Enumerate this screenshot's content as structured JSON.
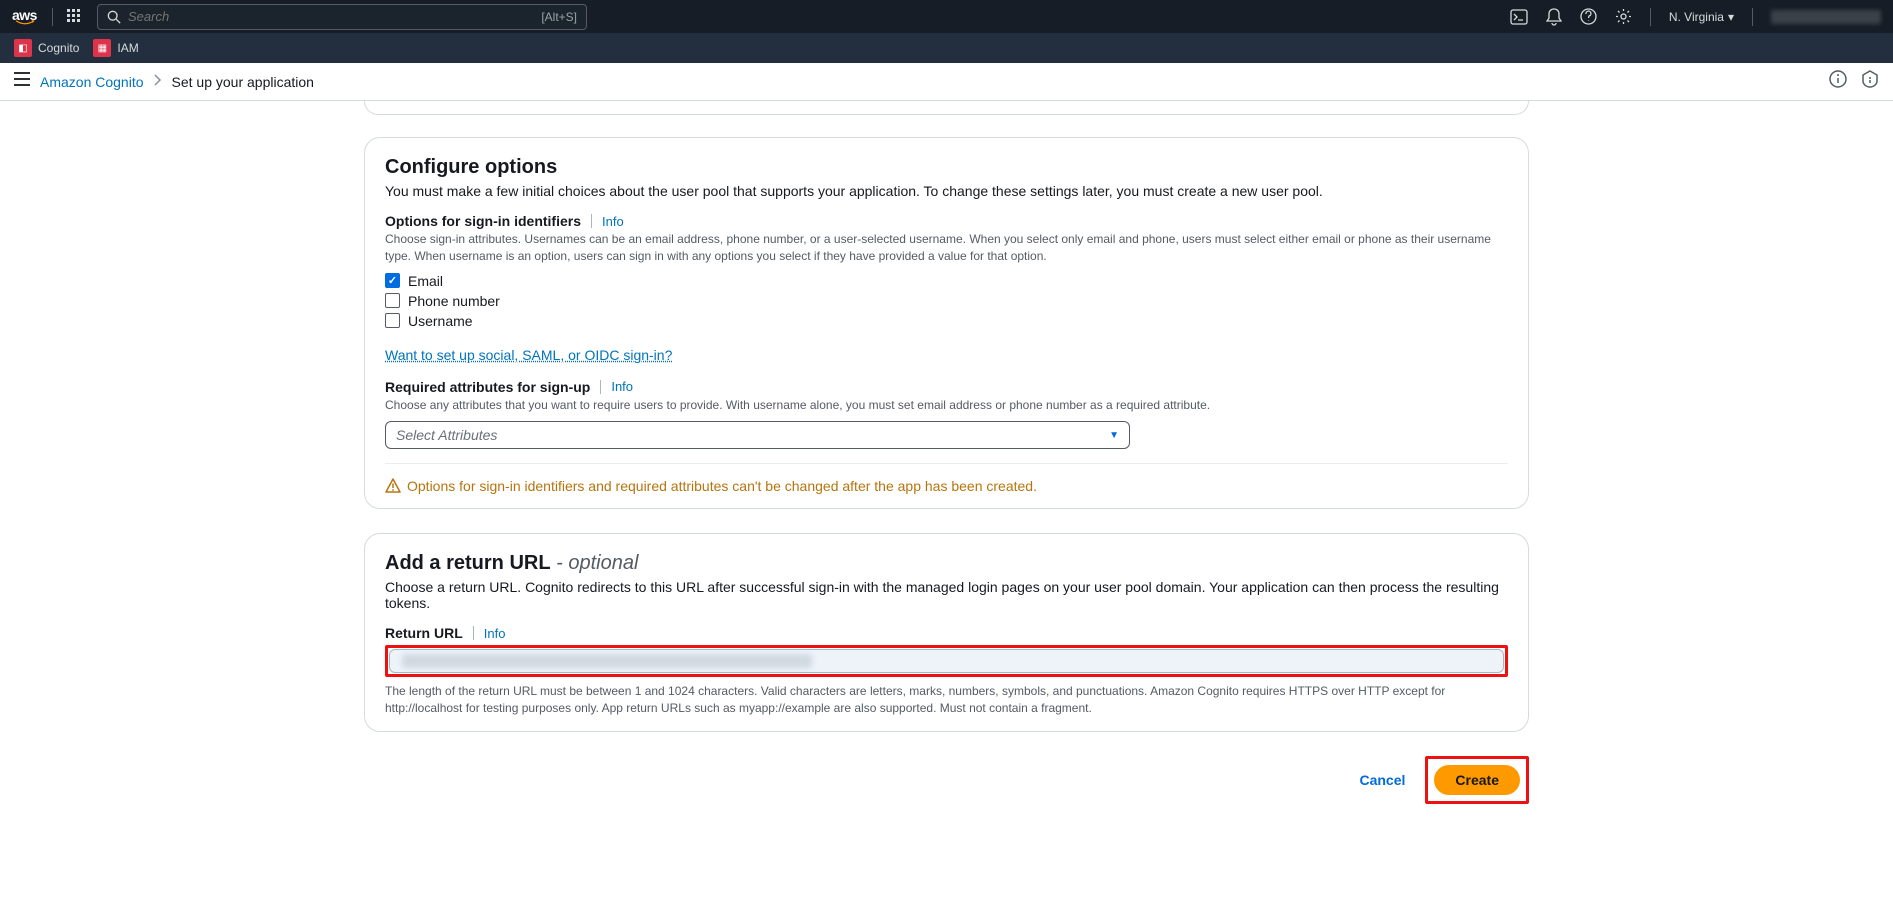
{
  "header": {
    "search_placeholder": "Search",
    "search_shortcut": "[Alt+S]",
    "region": "N. Virginia"
  },
  "services": {
    "cognito": "Cognito",
    "iam": "IAM"
  },
  "breadcrumb": {
    "root": "Amazon Cognito",
    "current": "Set up your application"
  },
  "configure": {
    "title": "Configure options",
    "subtitle": "You must make a few initial choices about the user pool that supports your application. To change these settings later, you must create a new user pool.",
    "signin_label": "Options for sign-in identifiers",
    "info": "Info",
    "signin_desc": "Choose sign-in attributes. Usernames can be an email address, phone number, or a user-selected username. When you select only email and phone, users must select either email or phone as their username type. When username is an option, users can sign in with any options you select if they have provided a value for that option.",
    "opt_email": "Email",
    "opt_phone": "Phone number",
    "opt_username": "Username",
    "social_link": "Want to set up social, SAML, or OIDC sign-in?",
    "required_label": "Required attributes for sign-up",
    "required_desc": "Choose any attributes that you want to require users to provide. With username alone, you must set email address or phone number as a required attribute.",
    "select_placeholder": "Select Attributes",
    "warning": "Options for sign-in identifiers and required attributes can't be changed after the app has been created."
  },
  "return_url": {
    "title": "Add a return URL",
    "optional": " - optional",
    "subtitle": "Choose a return URL. Cognito redirects to this URL after successful sign-in with the managed login pages on your user pool domain. Your application can then process the resulting tokens.",
    "label": "Return URL",
    "info": "Info",
    "help": "The length of the return URL must be between 1 and 1024 characters. Valid characters are letters, marks, numbers, symbols, and punctuations. Amazon Cognito requires HTTPS over HTTP except for http://localhost for testing purposes only. App return URLs such as myapp://example are also supported. Must not contain a fragment."
  },
  "actions": {
    "cancel": "Cancel",
    "create": "Create"
  }
}
